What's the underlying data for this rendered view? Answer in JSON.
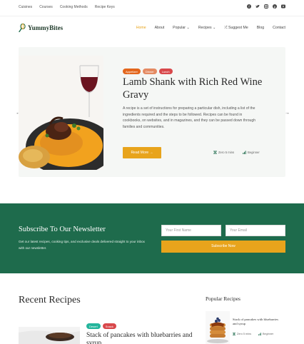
{
  "topbar": {
    "links": [
      "Cuisines",
      "Courses",
      "Cooking Methods",
      "Recipe Keys"
    ],
    "socials": [
      "facebook-icon",
      "twitter-icon",
      "instagram-icon",
      "pinterest-icon",
      "youtube-icon"
    ]
  },
  "header": {
    "logo": "YummyBites",
    "nav": [
      "Home",
      "About",
      "Popular",
      "Recipes",
      "Suggest Me",
      "Blog",
      "Contact"
    ],
    "active_index": 0,
    "accent": "#e8a41c"
  },
  "hero": {
    "tags": [
      {
        "label": "Appetizer",
        "color": "#e3661c"
      },
      {
        "label": "Dinner",
        "color": "#e48a62"
      },
      {
        "label": "Lunch",
        "color": "#d8484b"
      }
    ],
    "title": "Lamb Shank with Rich Red Wine Gravy",
    "description": "A recipe is a set of instructions for preparing a particular dish, including a list of the ingredients required and the steps to be followed. Recipes can be found in cookbooks, on websites, and in magazines, and they can be passed down through families and communities.",
    "cta": "Read More →",
    "time": "Zero 5 mins",
    "difficulty": "Beginner",
    "prev_arrow": "←",
    "next_arrow": "→"
  },
  "newsletter": {
    "title": "Subscribe To Our Newsletter",
    "text": "Get our latest recipes, cooking tips, and exclusive deals delivered straight to your inbox with our newsletter.",
    "first_name_placeholder": "Your First Name",
    "email_placeholder": "Your Email",
    "button": "Subscribe Now",
    "bg": "#1e6b4c"
  },
  "recent": {
    "title": "Recent Recipes",
    "card": {
      "tags": [
        {
          "label": "Desert",
          "color": "#24b59c"
        },
        {
          "label": "Snack",
          "color": "#d8484b"
        }
      ],
      "title": "Stack of pancakes with bluebarries and syrup"
    }
  },
  "popular": {
    "title": "Popular Recipes",
    "item": {
      "title": "Stack of pancakes with bluebarries and syrup",
      "time": "Zero 5 mins",
      "difficulty": "Beginner"
    }
  }
}
